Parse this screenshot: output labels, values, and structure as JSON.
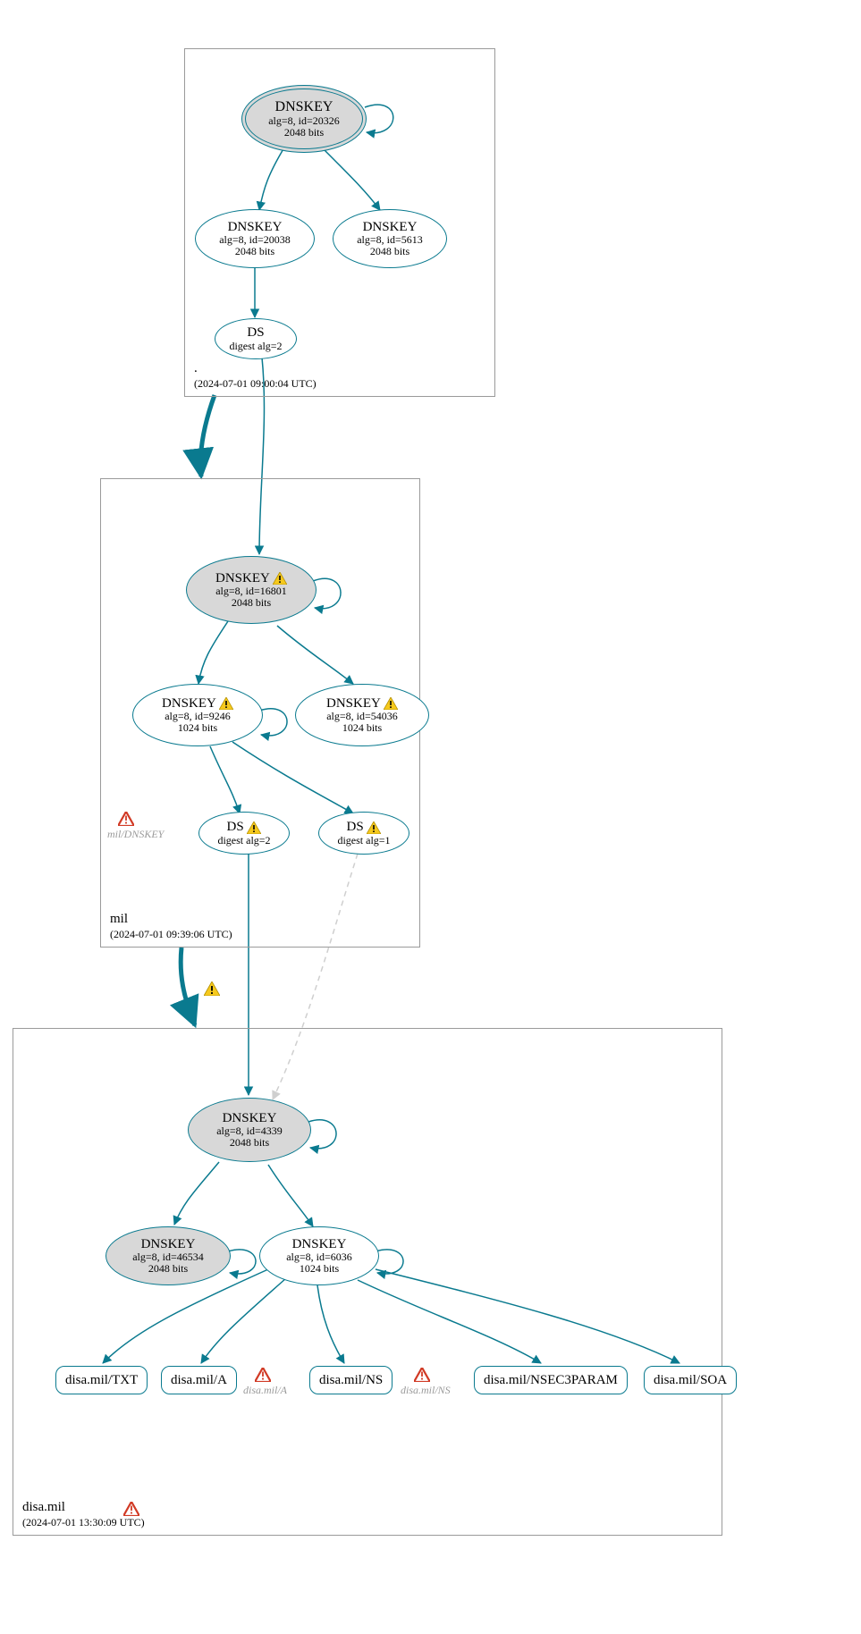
{
  "zones": {
    "root": {
      "label": ".",
      "timestamp": "(2024-07-01 09:00:04 UTC)"
    },
    "mil": {
      "label": "mil",
      "timestamp": "(2024-07-01 09:39:06 UTC)"
    },
    "disa": {
      "label": "disa.mil",
      "timestamp": "(2024-07-01 13:30:09 UTC)"
    }
  },
  "nodes": {
    "root_ksk": {
      "title": "DNSKEY",
      "line2": "alg=8, id=20326",
      "line3": "2048 bits"
    },
    "root_zsk1": {
      "title": "DNSKEY",
      "line2": "alg=8, id=20038",
      "line3": "2048 bits"
    },
    "root_zsk2": {
      "title": "DNSKEY",
      "line2": "alg=8, id=5613",
      "line3": "2048 bits"
    },
    "root_ds": {
      "title": "DS",
      "line2": "digest alg=2"
    },
    "mil_ksk": {
      "title": "DNSKEY",
      "line2": "alg=8, id=16801",
      "line3": "2048 bits"
    },
    "mil_zsk1": {
      "title": "DNSKEY",
      "line2": "alg=8, id=9246",
      "line3": "1024 bits"
    },
    "mil_zsk2": {
      "title": "DNSKEY",
      "line2": "alg=8, id=54036",
      "line3": "1024 bits"
    },
    "mil_ds2": {
      "title": "DS",
      "line2": "digest alg=2"
    },
    "mil_ds1": {
      "title": "DS",
      "line2": "digest alg=1"
    },
    "disa_ksk": {
      "title": "DNSKEY",
      "line2": "alg=8, id=4339",
      "line3": "2048 bits"
    },
    "disa_k2": {
      "title": "DNSKEY",
      "line2": "alg=8, id=46534",
      "line3": "2048 bits"
    },
    "disa_zsk": {
      "title": "DNSKEY",
      "line2": "alg=8, id=6036",
      "line3": "1024 bits"
    },
    "rr_txt": {
      "label": "disa.mil/TXT"
    },
    "rr_a": {
      "label": "disa.mil/A"
    },
    "rr_ns": {
      "label": "disa.mil/NS"
    },
    "rr_nsec3": {
      "label": "disa.mil/NSEC3PARAM"
    },
    "rr_soa": {
      "label": "disa.mil/SOA"
    }
  },
  "warn_labels": {
    "mil_dnskey": "mil/DNSKEY",
    "disa_a": "disa.mil/A",
    "disa_ns": "disa.mil/NS"
  },
  "colors": {
    "teal": "#0a7a8f",
    "grey_dash": "#cfcfcf",
    "warn_yellow": "#f6c91d",
    "err_red": "#d13a25"
  }
}
